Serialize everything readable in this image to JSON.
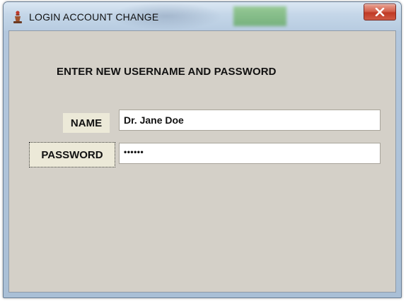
{
  "window": {
    "title": "LOGIN ACCOUNT CHANGE",
    "close_icon": "close-icon",
    "app_icon": "chess-piece-icon"
  },
  "form": {
    "heading": "ENTER NEW USERNAME AND PASSWORD",
    "name_label": "NAME",
    "name_value": "Dr. Jane Doe",
    "password_label": "PASSWORD",
    "password_value": "••••••"
  },
  "colors": {
    "client_background": "#d4d0c8",
    "close_button": "#c03a25"
  }
}
